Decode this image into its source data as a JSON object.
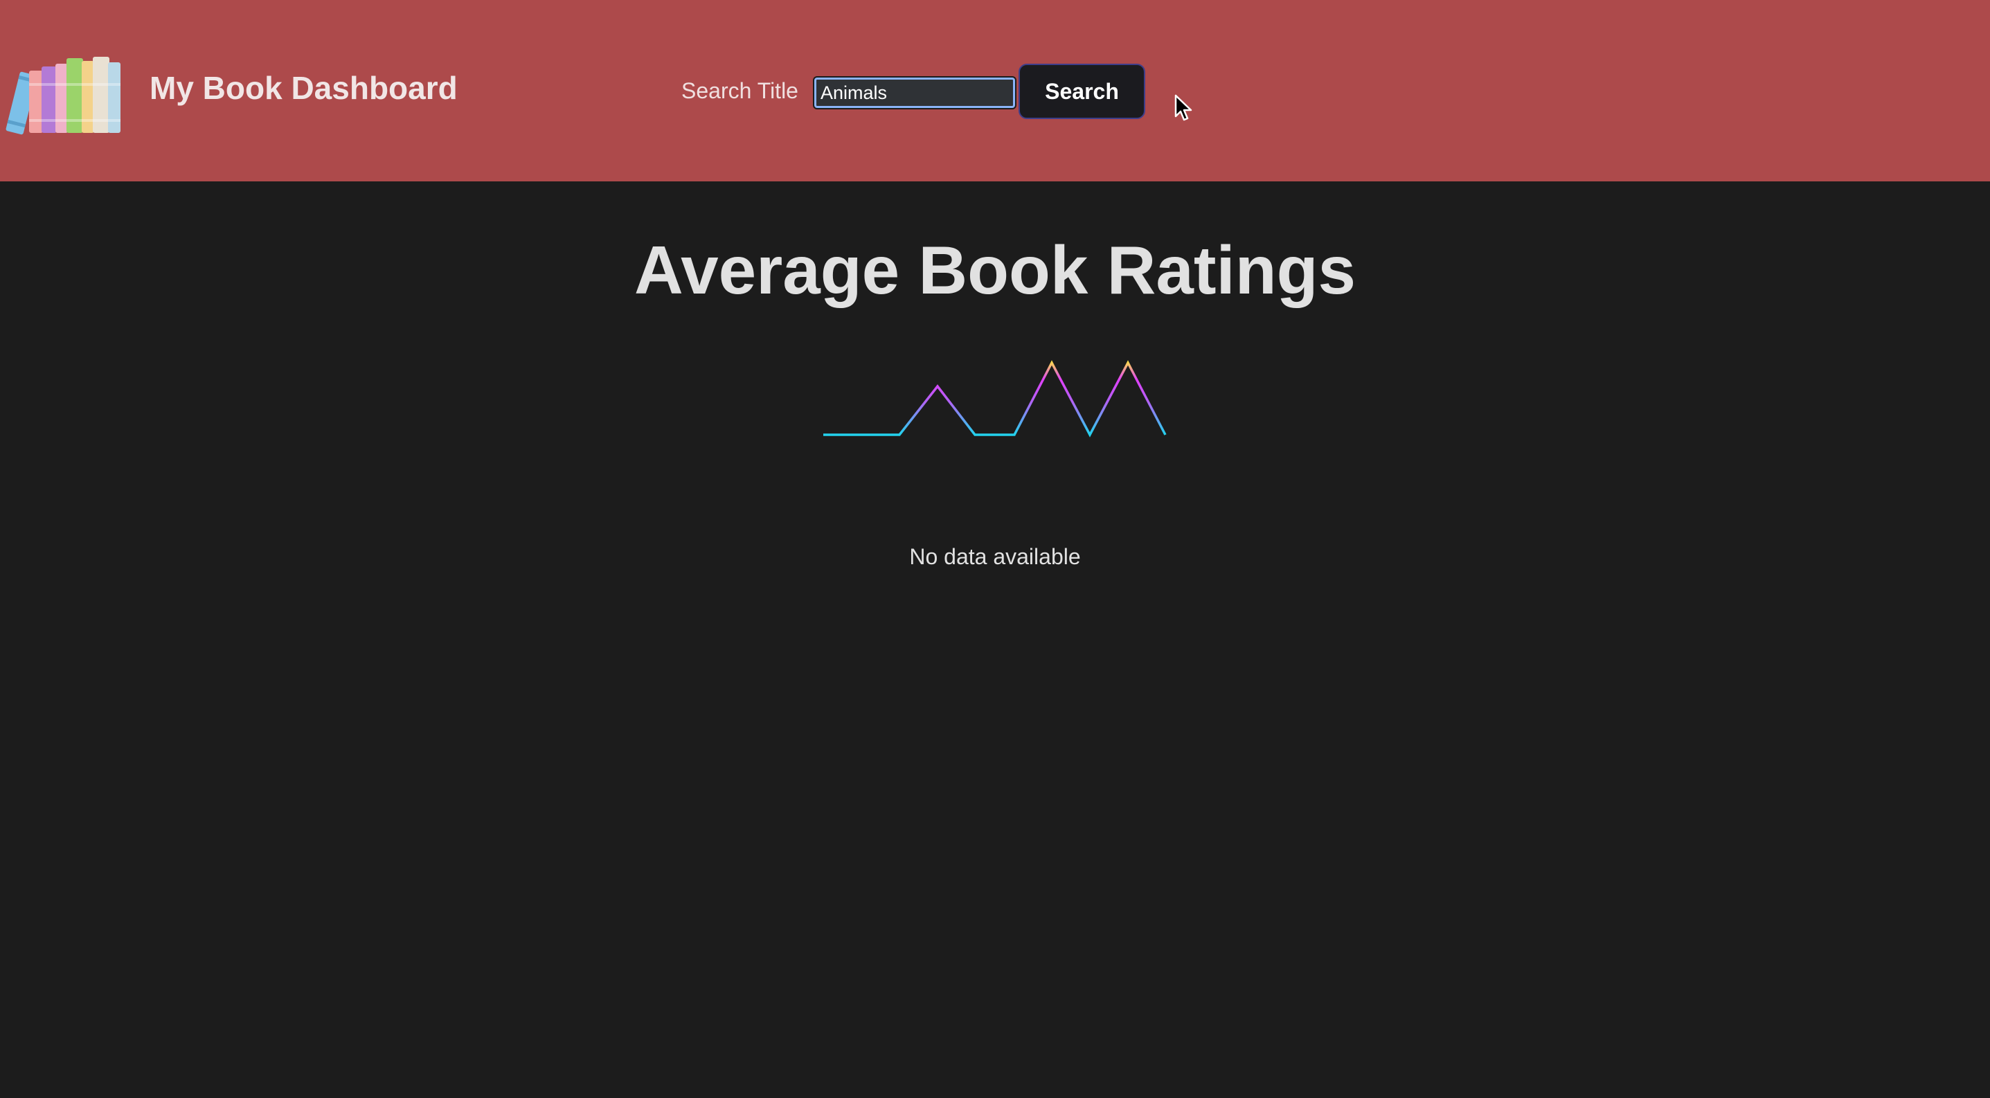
{
  "header": {
    "app_title": "My Book Dashboard",
    "logo_icon": "books-icon",
    "search": {
      "label": "Search Title",
      "value": "Animals",
      "button_label": "Search"
    }
  },
  "main": {
    "title": "Average Book Ratings",
    "loading_icon": "sparkline-loader-icon",
    "empty_message": "No data available"
  },
  "colors": {
    "header_bg": "#ad4a4b",
    "page_bg": "#1c1c1c",
    "accent_cyan": "#22d3ee",
    "accent_magenta": "#e040fb",
    "accent_yellow": "#fde047"
  }
}
